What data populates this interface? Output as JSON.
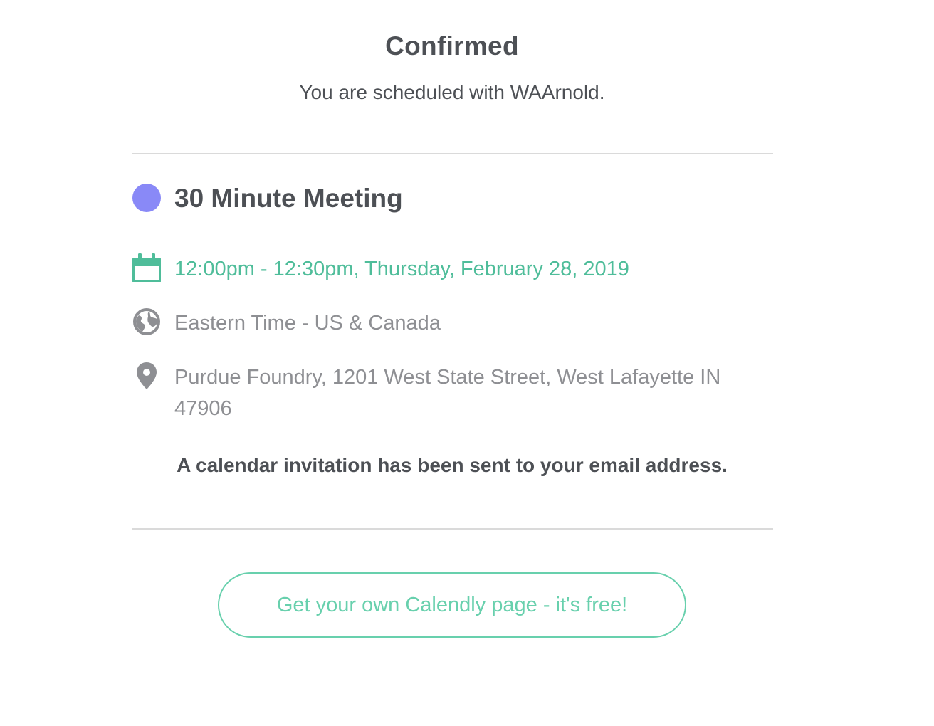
{
  "header": {
    "title": "Confirmed",
    "subtitle": "You are scheduled with WAArnold."
  },
  "event": {
    "name": "30 Minute Meeting",
    "color": "#8989f7"
  },
  "details": {
    "datetime": "12:00pm - 12:30pm, Thursday, February 28, 2019",
    "timezone": "Eastern Time - US & Canada",
    "location": "Purdue Foundry, 1201 West State Street, West Lafayette IN 47906"
  },
  "icons": {
    "datetime": "calendar-icon",
    "timezone": "globe-icon",
    "location": "map-pin-icon"
  },
  "note": "A calendar invitation has been sent to your email address.",
  "cta": {
    "label": "Get your own Calendly page - it's free!"
  },
  "colors": {
    "accent_green": "#4fbd9a",
    "button_green": "#68d0ad",
    "event_purple": "#8989f7",
    "text_dark": "#4d5055",
    "text_muted": "#8e8f93",
    "divider": "#dadada"
  }
}
